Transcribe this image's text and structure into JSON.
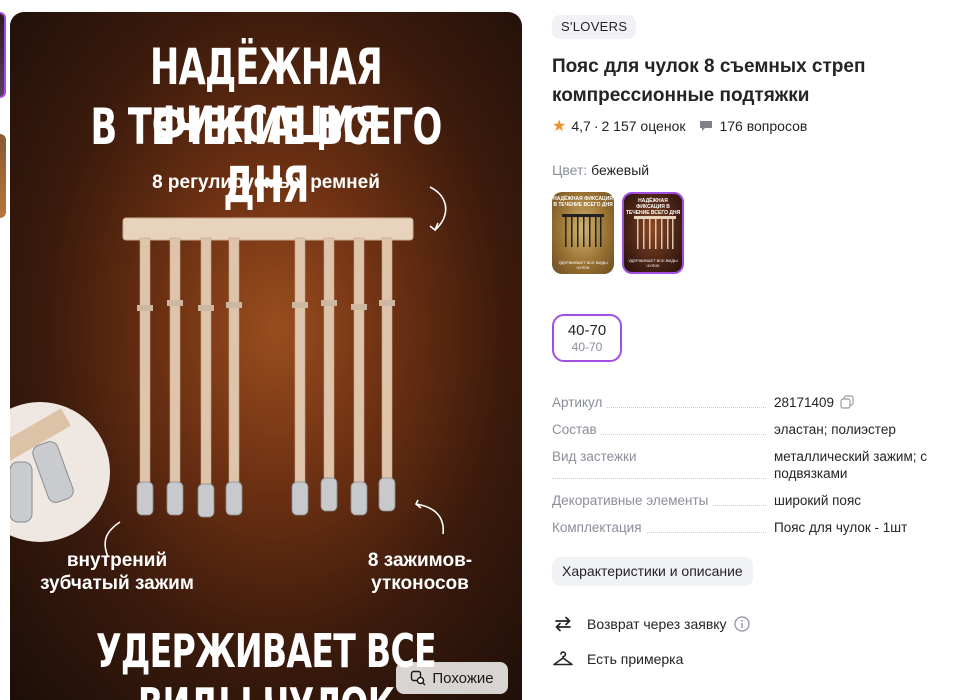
{
  "product_image": {
    "headline_line1": "НАДЁЖНАЯ ФИКСАЦИЯ",
    "headline_line2": "В ТЕЧЕНИЕ ВСЕГО ДНЯ",
    "label_straps": "8 регулируемых ремней",
    "label_inner_line1": "внутрений",
    "label_inner_line2": "зубчатый зажим",
    "label_clips_line1": "8 зажимов-",
    "label_clips_line2": "утконосов",
    "bottom_caption": "УДЕРЖИВАЕТ ВСЕ ВИДЫ ЧУЛОК",
    "similar_button": "Похожие"
  },
  "product": {
    "brand": "S'LOVERS",
    "title": "Пояс для чулок 8 съемных стреп компрессионные подтяжки",
    "rating": "4,7",
    "reviews": "2 157 оценок",
    "rating_separator": "·",
    "questions": "176 вопросов",
    "color_label": "Цвет:",
    "color_value": "бежевый",
    "swatches": [
      {
        "title": "НАДЁЖНАЯ ФИКСАЦИЯ В ТЕЧЕНИЕ ВСЕГО ДНЯ",
        "footer": "УДЕРЖИВАЕТ ВСЕ ВИДЫ ЧУЛОК"
      },
      {
        "title": "НАДЁЖНАЯ ФИКСАЦИЯ В ТЕЧЕНИЕ ВСЕГО ДНЯ",
        "footer": "УДЕРЖИВАЕТ ВСЕ ВИДЫ ЧУЛОК"
      }
    ],
    "size": {
      "main": "40-70",
      "sub": "40-70"
    }
  },
  "specs": [
    {
      "key": "Артикул",
      "value": "28171409"
    },
    {
      "key": "Состав",
      "value": "эластан; полиэстер"
    },
    {
      "key": "Вид застежки",
      "value": "металлический зажим; с подвязками"
    },
    {
      "key": "Декоративные элементы",
      "value": "широкий пояс"
    },
    {
      "key": "Комплектация",
      "value": "Пояс для чулок - 1шт"
    }
  ],
  "characteristics_button": "Характеристики и описание",
  "features": {
    "return": "Возврат через заявку",
    "fitting": "Есть примерка"
  },
  "colors": {
    "accent": "#a14fe3",
    "star": "#f1902b",
    "muted_text": "#8b8e99"
  }
}
